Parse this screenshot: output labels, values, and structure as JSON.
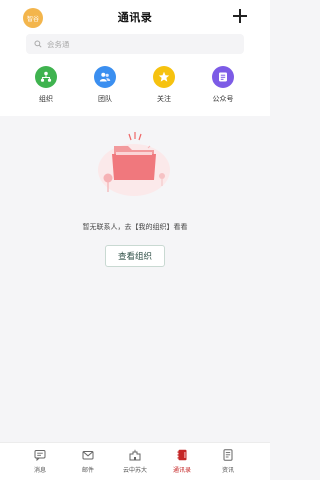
{
  "header": {
    "avatar_text": "智谷",
    "title": "通讯录"
  },
  "search": {
    "placeholder": "会务通"
  },
  "quick_links": [
    {
      "label": "组织",
      "icon": "org-icon",
      "color": "#3fb34f"
    },
    {
      "label": "团队",
      "icon": "team-icon",
      "color": "#3b8ff0"
    },
    {
      "label": "关注",
      "icon": "star-icon",
      "color": "#f6c20f"
    },
    {
      "label": "公众号",
      "icon": "public-account-icon",
      "color": "#7c5be6"
    }
  ],
  "empty_state": {
    "message": "暂无联系人，去【我的组织】看看",
    "button_label": "查看组织"
  },
  "tabbar": {
    "items": [
      {
        "label": "消息",
        "icon": "message-icon"
      },
      {
        "label": "邮件",
        "icon": "mail-icon"
      },
      {
        "label": "云中苏大",
        "icon": "campus-icon"
      },
      {
        "label": "通讯录",
        "icon": "contacts-icon",
        "active": true
      },
      {
        "label": "资讯",
        "icon": "news-icon"
      }
    ],
    "active_color": "#c52727"
  }
}
